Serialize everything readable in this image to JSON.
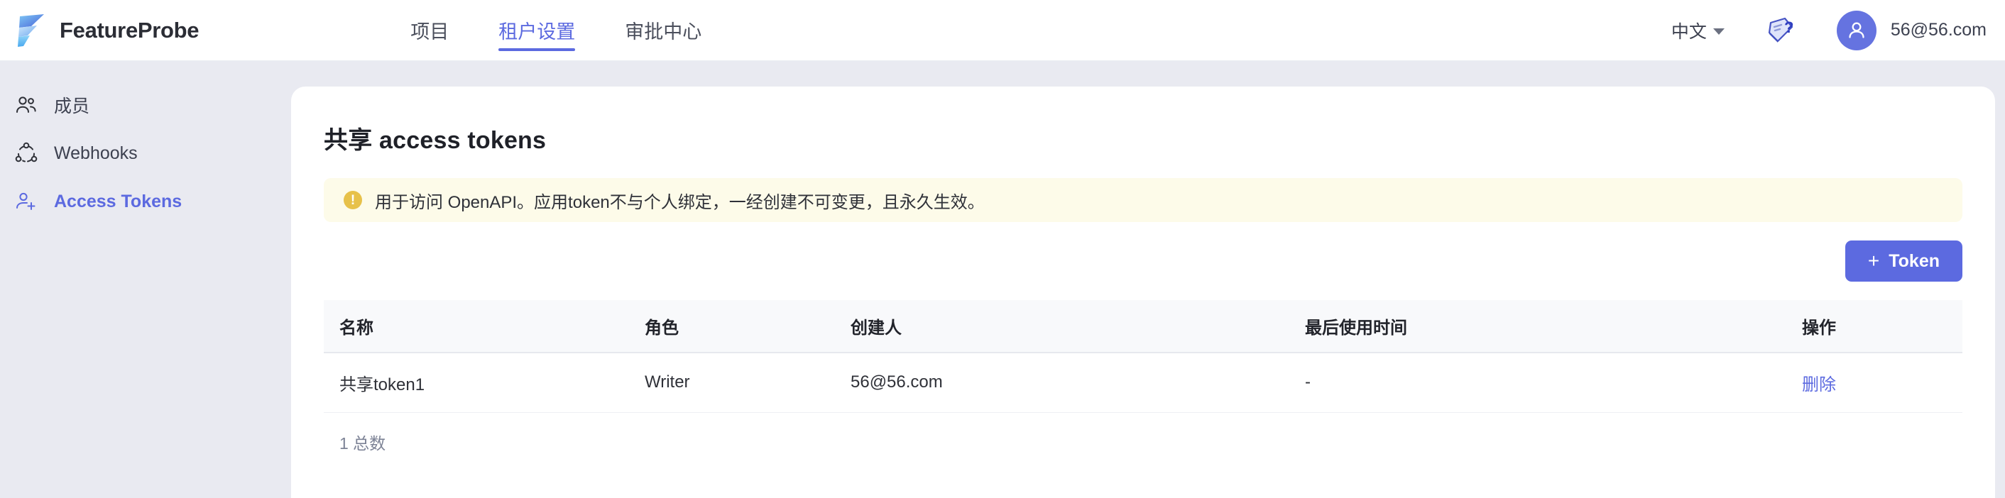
{
  "header": {
    "brand_name": "FeatureProbe",
    "brand_logo_icon": "featureprobe-logo-icon",
    "tabs": [
      {
        "label": "项目",
        "active": false
      },
      {
        "label": "租户设置",
        "active": true
      },
      {
        "label": "审批中心",
        "active": false
      }
    ],
    "language": {
      "label": "中文",
      "chevron_icon": "chevron-down-icon"
    },
    "help_icon": "help-document-icon",
    "avatar_icon": "user-avatar-icon",
    "user_email": "56@56.com",
    "accent_color": "#5c6ae0"
  },
  "sidebar": {
    "items": [
      {
        "label": "成员",
        "icon": "members-icon",
        "active": false
      },
      {
        "label": "Webhooks",
        "icon": "webhook-icon",
        "active": false
      },
      {
        "label": "Access Tokens",
        "icon": "user-add-icon",
        "active": true
      }
    ],
    "background_color": "#e9eaf1"
  },
  "main": {
    "title": "共享 access tokens",
    "alert": {
      "icon": "warning-exclamation-icon",
      "text": "用于访问 OpenAPI。应用token不与个人绑定，一经创建不可变更，且永久生效。",
      "background_color": "#fdfbe9",
      "icon_color": "#e7c14a"
    },
    "add_button": {
      "plus": "+",
      "label": "Token",
      "color": "#5c6ae0"
    },
    "table": {
      "columns": [
        "名称",
        "角色",
        "创建人",
        "最后使用时间",
        "操作"
      ],
      "rows": [
        {
          "name": "共享token1",
          "role": "Writer",
          "creator": "56@56.com",
          "last_used": "-",
          "action": "删除"
        }
      ],
      "footer": "1 总数"
    }
  }
}
